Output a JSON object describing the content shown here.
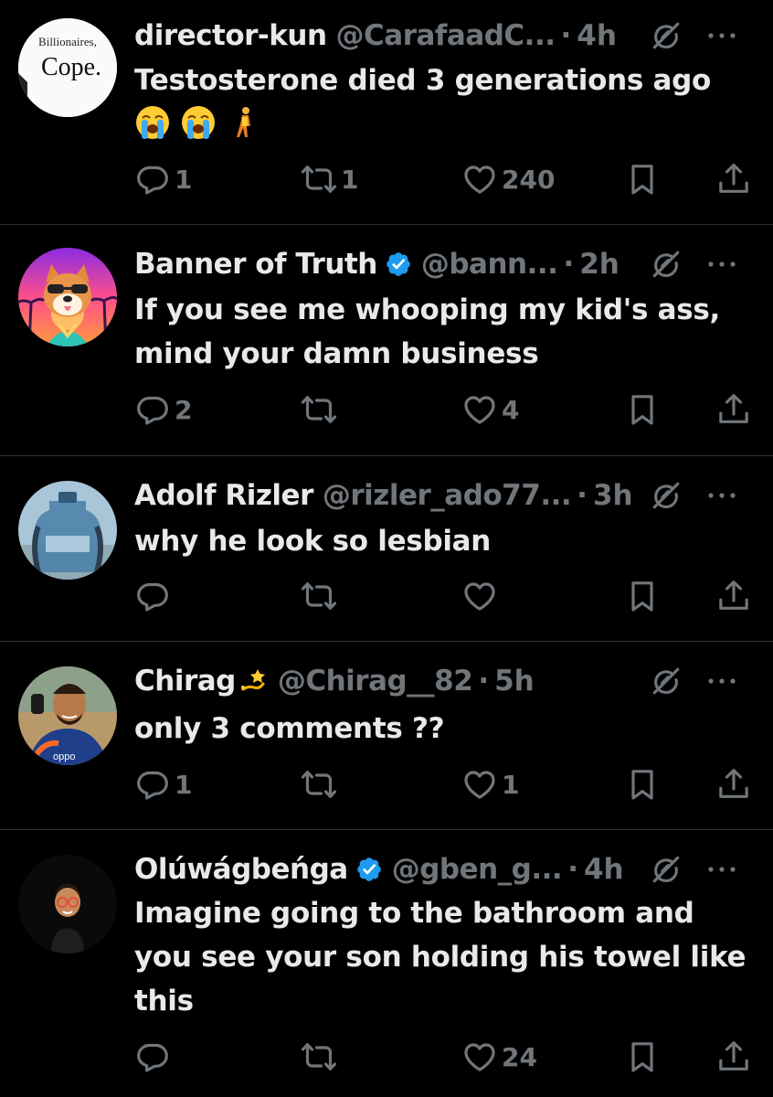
{
  "tweets": [
    {
      "name": "director-kun",
      "handle": "@CarafaadC...",
      "time": "4h",
      "verified": false,
      "text": "Testosterone died 3 generations ago",
      "avatar_text_top": "Billionaires,",
      "avatar_text_main": "Cope.",
      "replies": "1",
      "reposts": "1",
      "likes": "240"
    },
    {
      "name": "Banner of Truth",
      "handle": "@bann...",
      "time": "2h",
      "verified": true,
      "text": "If you see me whooping my kid's ass, mind your damn business",
      "replies": "2",
      "reposts": "",
      "likes": "4"
    },
    {
      "name": "Adolf Rizler",
      "handle": "@rizler_ado77...",
      "time": "3h",
      "verified": false,
      "text": "why he look so lesbian",
      "replies": "",
      "reposts": "",
      "likes": ""
    },
    {
      "name": "Chirag",
      "handle": "@Chirag__82",
      "time": "5h",
      "verified": false,
      "text": "only 3 comments ??",
      "avatar_text": "oppo",
      "replies": "1",
      "reposts": "",
      "likes": "1"
    },
    {
      "name": "Olúwágbeńga",
      "handle": "@gben_g...",
      "time": "4h",
      "verified": true,
      "text": "Imagine going to the bathroom and you see your son holding his towel like this",
      "replies": "",
      "reposts": "",
      "likes": "24"
    }
  ],
  "separator": "·",
  "icons": {
    "reply": "reply-icon",
    "repost": "repost-icon",
    "like": "heart-icon",
    "bookmark": "bookmark-icon",
    "share": "share-icon",
    "grok": "grok-icon",
    "more": "more-icon",
    "verified": "verified-badge-icon"
  },
  "colors": {
    "background": "#000000",
    "text": "#e7e9ea",
    "muted": "#71767b",
    "divider": "#2f3336",
    "verified": "#1d9bf0"
  }
}
